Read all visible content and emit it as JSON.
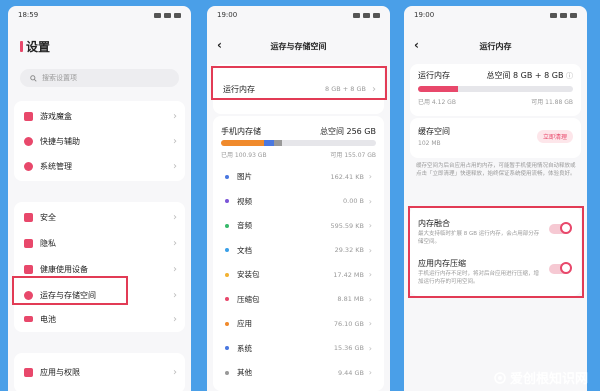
{
  "screen1": {
    "time": "18:59",
    "title": "设置",
    "search_placeholder": "搜索设置项",
    "group1": [
      {
        "label": "游戏魔盒",
        "color": "#e8486b"
      },
      {
        "label": "快捷与辅助",
        "color": "#e8486b"
      },
      {
        "label": "系统管理",
        "color": "#e8486b"
      }
    ],
    "group2": [
      {
        "label": "安全",
        "color": "#e8486b"
      },
      {
        "label": "隐私",
        "color": "#e8486b"
      },
      {
        "label": "健康使用设备",
        "color": "#e8486b"
      },
      {
        "label": "运存与存储空间",
        "color": "#e8486b"
      },
      {
        "label": "电池",
        "color": "#e8486b"
      }
    ],
    "group3": [
      {
        "label": "应用与权限",
        "color": "#e8486b"
      }
    ]
  },
  "screen2": {
    "time": "19:00",
    "title": "运存与存储空间",
    "ram_label": "运行内存",
    "ram_value": "8 GB + 8 GB",
    "storage_label": "手机内存储",
    "storage_total": "总空间 256 GB",
    "storage_used": "已用 100.93 GB",
    "storage_free": "可用 155.07 GB",
    "storage_used_fraction": 0.394,
    "categories": [
      {
        "label": "图片",
        "size": "162.41 KB",
        "color": "#4a78e0"
      },
      {
        "label": "视频",
        "size": "0.00 B",
        "color": "#7b55d8"
      },
      {
        "label": "音频",
        "size": "595.59 KB",
        "color": "#38b96b"
      },
      {
        "label": "文档",
        "size": "29.32 KB",
        "color": "#3aa0e8"
      },
      {
        "label": "安装包",
        "size": "17.42 MB",
        "color": "#f2b233"
      },
      {
        "label": "压缩包",
        "size": "8.81 MB",
        "color": "#e8486b"
      },
      {
        "label": "应用",
        "size": "76.10 GB",
        "color": "#f08a2c"
      },
      {
        "label": "系统",
        "size": "15.36 GB",
        "color": "#4a78e0"
      },
      {
        "label": "其他",
        "size": "9.44 GB",
        "color": "#999999"
      }
    ]
  },
  "screen3": {
    "time": "19:00",
    "title": "运行内存",
    "ram_label": "运行内存",
    "ram_total": "总空间 8 GB + 8 GB",
    "ram_used": "已用 4.12 GB",
    "ram_free": "可用 11.88 GB",
    "ram_used_fraction": 0.26,
    "cache_label": "缓存空间",
    "cache_value": "102 MB",
    "clean_button": "立即清理",
    "cache_desc": "缓存空间为后台应用占用的内存，可能暂手机使用情况自动释放或点击「立即清理」快速释放，始终保证系统使用流畅，体验良好。",
    "fusion_label": "内存融合",
    "fusion_desc": "最大支持临时扩展 8 GB 运行内存，会占用部分存储空间。",
    "compress_label": "应用内存压缩",
    "compress_desc": "手机运行内存不足时，将对后台应用进行压缩，增加运行内存的可用空间。"
  },
  "watermark": "爱创根知识网"
}
